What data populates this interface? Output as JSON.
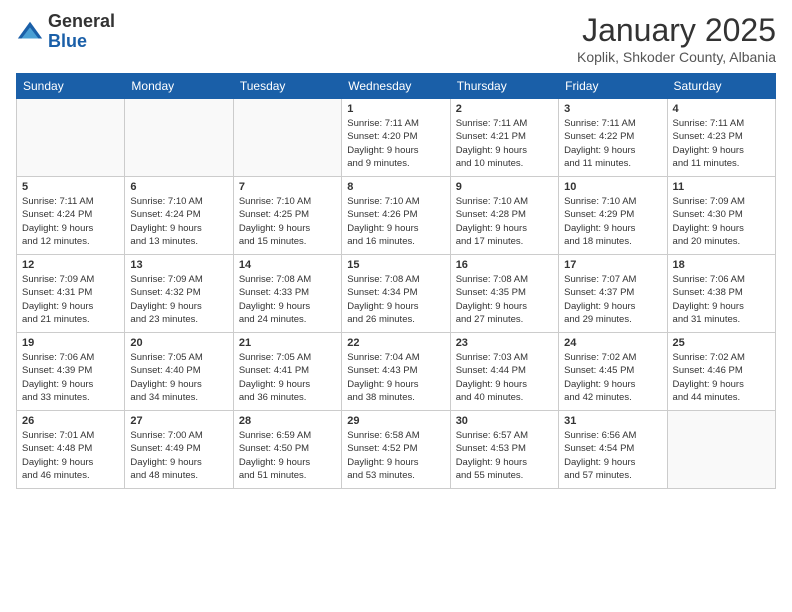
{
  "header": {
    "logo_general": "General",
    "logo_blue": "Blue",
    "month": "January 2025",
    "location": "Koplik, Shkoder County, Albania"
  },
  "days_of_week": [
    "Sunday",
    "Monday",
    "Tuesday",
    "Wednesday",
    "Thursday",
    "Friday",
    "Saturday"
  ],
  "weeks": [
    [
      {
        "day": "",
        "info": ""
      },
      {
        "day": "",
        "info": ""
      },
      {
        "day": "",
        "info": ""
      },
      {
        "day": "1",
        "info": "Sunrise: 7:11 AM\nSunset: 4:20 PM\nDaylight: 9 hours\nand 9 minutes."
      },
      {
        "day": "2",
        "info": "Sunrise: 7:11 AM\nSunset: 4:21 PM\nDaylight: 9 hours\nand 10 minutes."
      },
      {
        "day": "3",
        "info": "Sunrise: 7:11 AM\nSunset: 4:22 PM\nDaylight: 9 hours\nand 11 minutes."
      },
      {
        "day": "4",
        "info": "Sunrise: 7:11 AM\nSunset: 4:23 PM\nDaylight: 9 hours\nand 11 minutes."
      }
    ],
    [
      {
        "day": "5",
        "info": "Sunrise: 7:11 AM\nSunset: 4:24 PM\nDaylight: 9 hours\nand 12 minutes."
      },
      {
        "day": "6",
        "info": "Sunrise: 7:10 AM\nSunset: 4:24 PM\nDaylight: 9 hours\nand 13 minutes."
      },
      {
        "day": "7",
        "info": "Sunrise: 7:10 AM\nSunset: 4:25 PM\nDaylight: 9 hours\nand 15 minutes."
      },
      {
        "day": "8",
        "info": "Sunrise: 7:10 AM\nSunset: 4:26 PM\nDaylight: 9 hours\nand 16 minutes."
      },
      {
        "day": "9",
        "info": "Sunrise: 7:10 AM\nSunset: 4:28 PM\nDaylight: 9 hours\nand 17 minutes."
      },
      {
        "day": "10",
        "info": "Sunrise: 7:10 AM\nSunset: 4:29 PM\nDaylight: 9 hours\nand 18 minutes."
      },
      {
        "day": "11",
        "info": "Sunrise: 7:09 AM\nSunset: 4:30 PM\nDaylight: 9 hours\nand 20 minutes."
      }
    ],
    [
      {
        "day": "12",
        "info": "Sunrise: 7:09 AM\nSunset: 4:31 PM\nDaylight: 9 hours\nand 21 minutes."
      },
      {
        "day": "13",
        "info": "Sunrise: 7:09 AM\nSunset: 4:32 PM\nDaylight: 9 hours\nand 23 minutes."
      },
      {
        "day": "14",
        "info": "Sunrise: 7:08 AM\nSunset: 4:33 PM\nDaylight: 9 hours\nand 24 minutes."
      },
      {
        "day": "15",
        "info": "Sunrise: 7:08 AM\nSunset: 4:34 PM\nDaylight: 9 hours\nand 26 minutes."
      },
      {
        "day": "16",
        "info": "Sunrise: 7:08 AM\nSunset: 4:35 PM\nDaylight: 9 hours\nand 27 minutes."
      },
      {
        "day": "17",
        "info": "Sunrise: 7:07 AM\nSunset: 4:37 PM\nDaylight: 9 hours\nand 29 minutes."
      },
      {
        "day": "18",
        "info": "Sunrise: 7:06 AM\nSunset: 4:38 PM\nDaylight: 9 hours\nand 31 minutes."
      }
    ],
    [
      {
        "day": "19",
        "info": "Sunrise: 7:06 AM\nSunset: 4:39 PM\nDaylight: 9 hours\nand 33 minutes."
      },
      {
        "day": "20",
        "info": "Sunrise: 7:05 AM\nSunset: 4:40 PM\nDaylight: 9 hours\nand 34 minutes."
      },
      {
        "day": "21",
        "info": "Sunrise: 7:05 AM\nSunset: 4:41 PM\nDaylight: 9 hours\nand 36 minutes."
      },
      {
        "day": "22",
        "info": "Sunrise: 7:04 AM\nSunset: 4:43 PM\nDaylight: 9 hours\nand 38 minutes."
      },
      {
        "day": "23",
        "info": "Sunrise: 7:03 AM\nSunset: 4:44 PM\nDaylight: 9 hours\nand 40 minutes."
      },
      {
        "day": "24",
        "info": "Sunrise: 7:02 AM\nSunset: 4:45 PM\nDaylight: 9 hours\nand 42 minutes."
      },
      {
        "day": "25",
        "info": "Sunrise: 7:02 AM\nSunset: 4:46 PM\nDaylight: 9 hours\nand 44 minutes."
      }
    ],
    [
      {
        "day": "26",
        "info": "Sunrise: 7:01 AM\nSunset: 4:48 PM\nDaylight: 9 hours\nand 46 minutes."
      },
      {
        "day": "27",
        "info": "Sunrise: 7:00 AM\nSunset: 4:49 PM\nDaylight: 9 hours\nand 48 minutes."
      },
      {
        "day": "28",
        "info": "Sunrise: 6:59 AM\nSunset: 4:50 PM\nDaylight: 9 hours\nand 51 minutes."
      },
      {
        "day": "29",
        "info": "Sunrise: 6:58 AM\nSunset: 4:52 PM\nDaylight: 9 hours\nand 53 minutes."
      },
      {
        "day": "30",
        "info": "Sunrise: 6:57 AM\nSunset: 4:53 PM\nDaylight: 9 hours\nand 55 minutes."
      },
      {
        "day": "31",
        "info": "Sunrise: 6:56 AM\nSunset: 4:54 PM\nDaylight: 9 hours\nand 57 minutes."
      },
      {
        "day": "",
        "info": ""
      }
    ]
  ]
}
